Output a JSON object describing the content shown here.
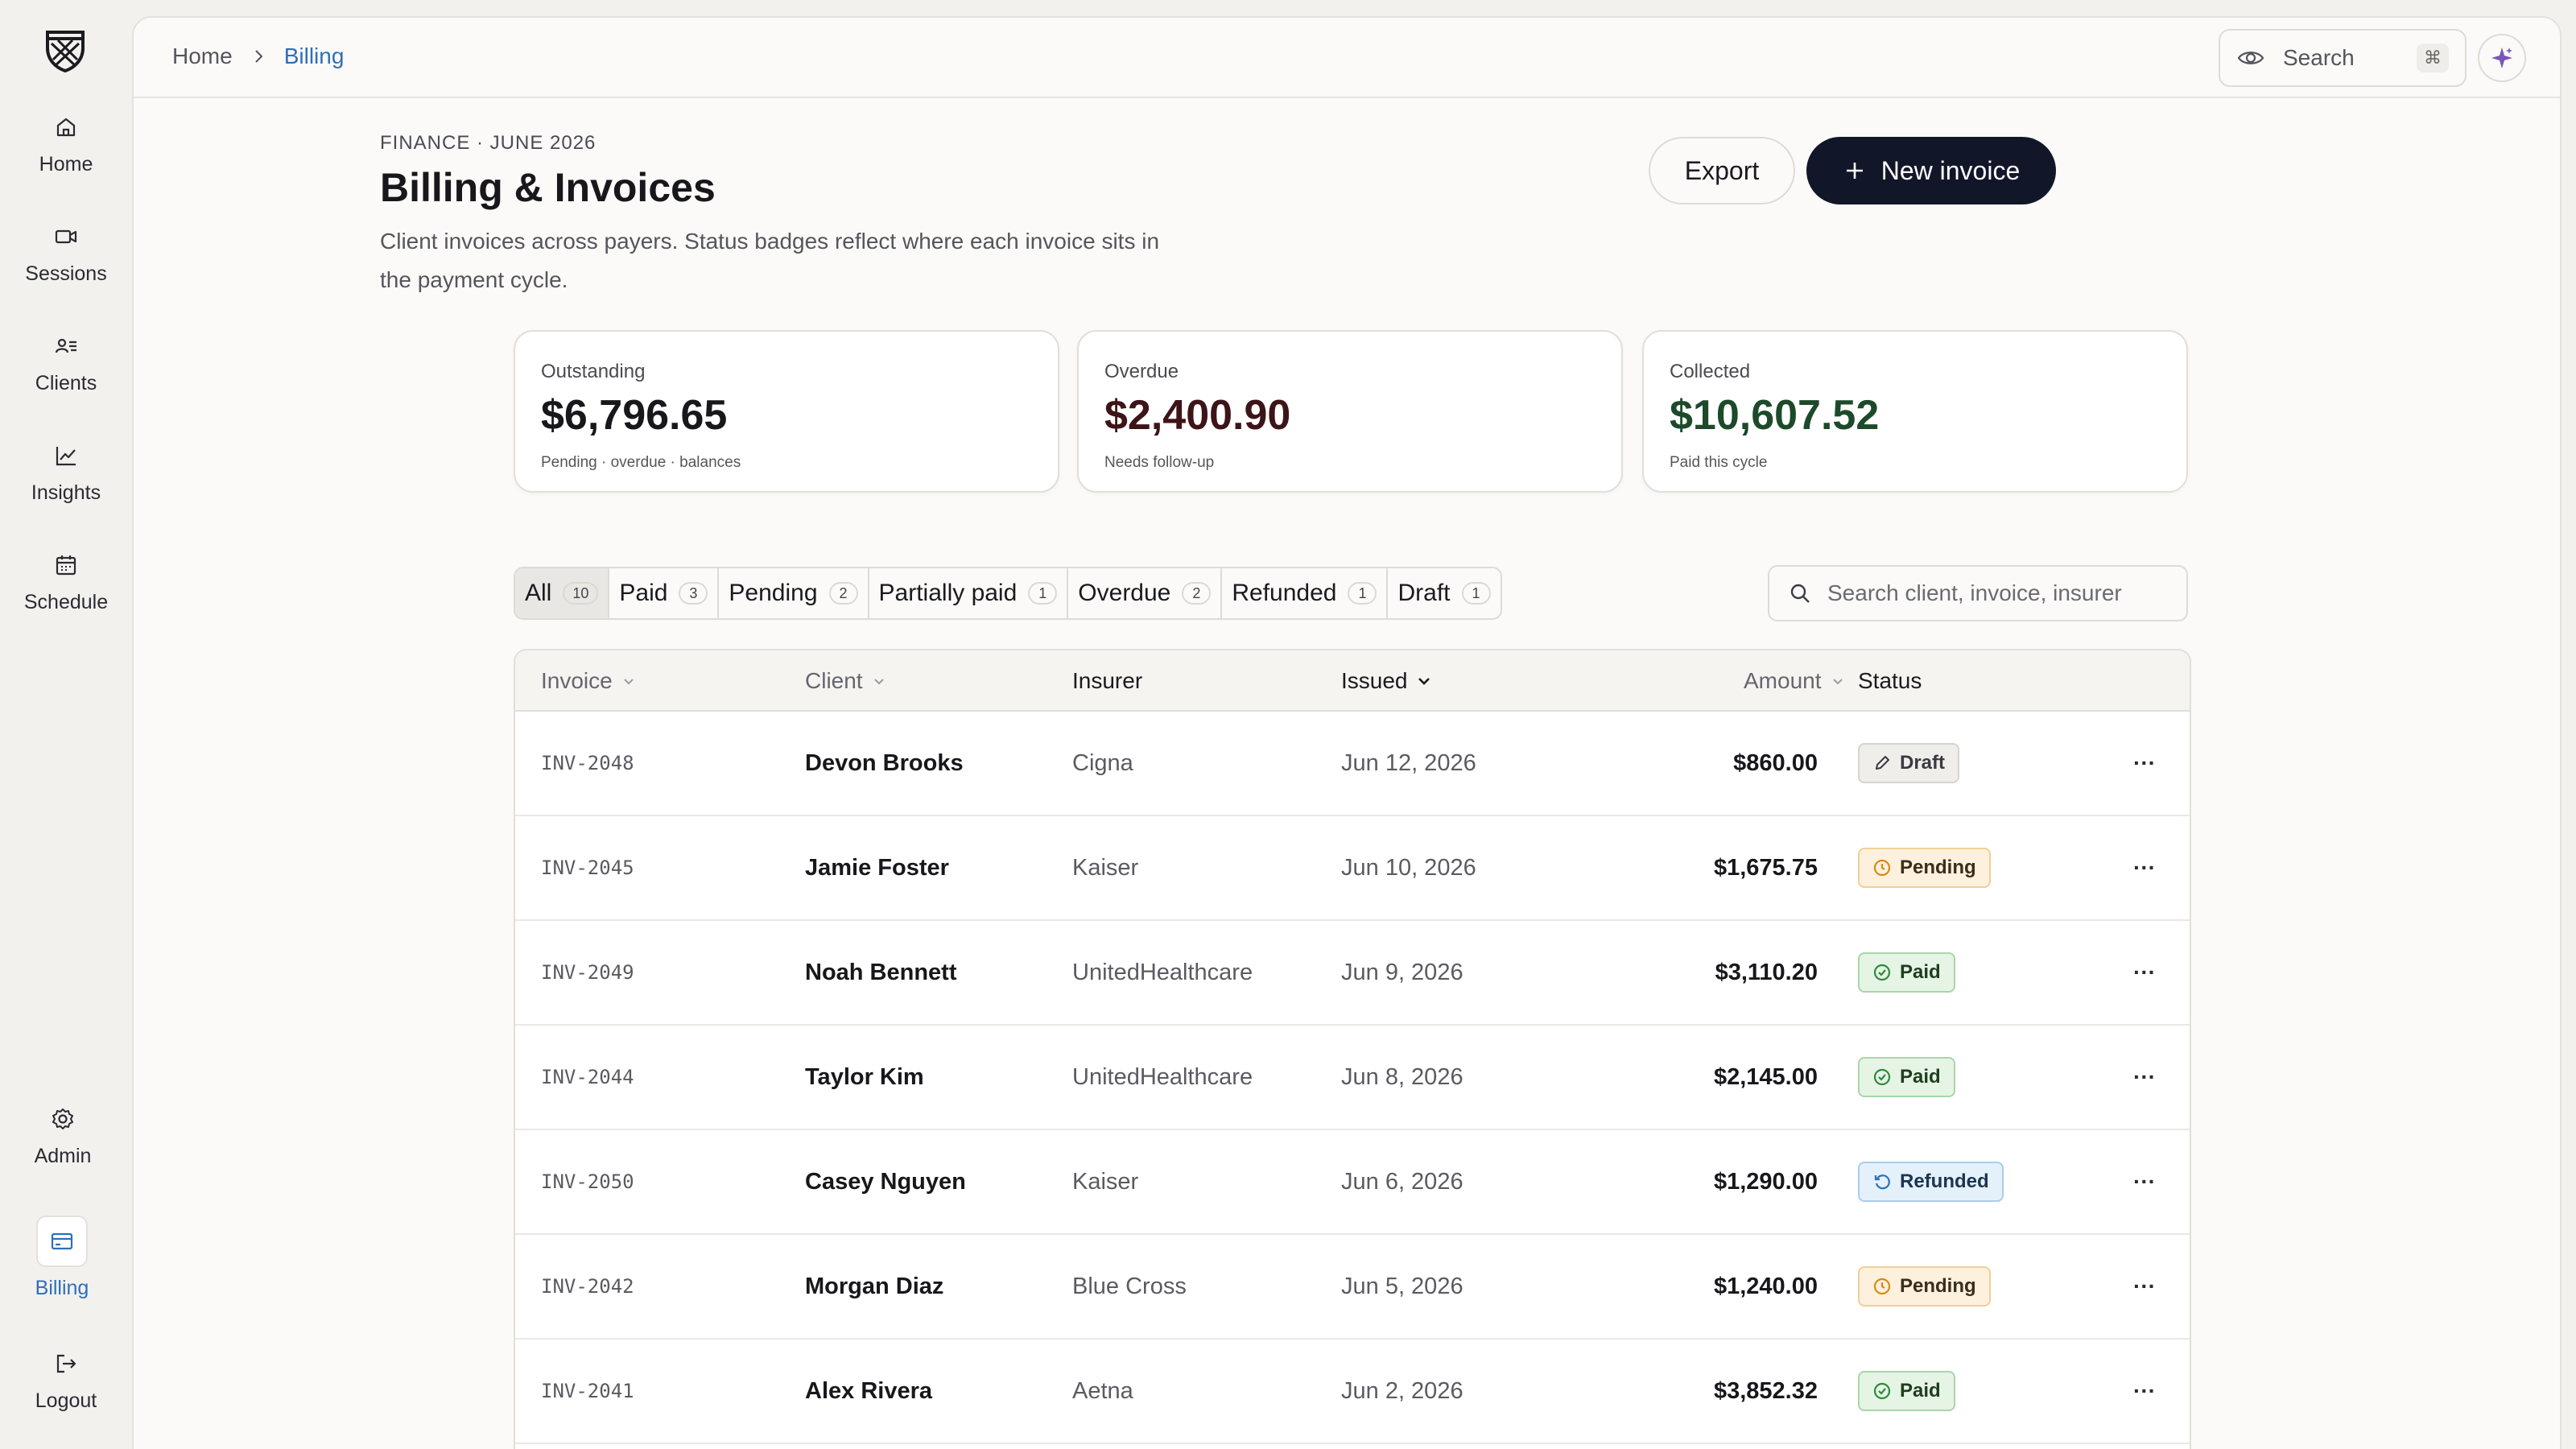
{
  "sidebar": {
    "items": [
      {
        "label": "Home",
        "icon": "home-icon"
      },
      {
        "label": "Sessions",
        "icon": "video-icon"
      },
      {
        "label": "Clients",
        "icon": "clients-icon"
      },
      {
        "label": "Insights",
        "icon": "chart-line-icon"
      },
      {
        "label": "Schedule",
        "icon": "calendar-icon"
      }
    ],
    "bottom": [
      {
        "label": "Admin",
        "icon": "gear-icon"
      },
      {
        "label": "Billing",
        "icon": "credit-card-icon",
        "active": true
      },
      {
        "label": "Logout",
        "icon": "logout-icon"
      }
    ]
  },
  "topbar": {
    "breadcrumb": {
      "home": "Home",
      "current": "Billing"
    },
    "search_label": "Search",
    "shortcut": "⌘"
  },
  "header": {
    "eyebrow": "FINANCE · JUNE 2026",
    "title": "Billing & Invoices",
    "subtitle": "Client invoices across payers. Status badges reflect where each invoice sits in the payment cycle.",
    "export_label": "Export",
    "new_invoice_label": "New invoice"
  },
  "stats": [
    {
      "label": "Outstanding",
      "value": "$6,796.65",
      "note": "Pending · overdue · balances",
      "color": "#17171c"
    },
    {
      "label": "Overdue",
      "value": "$2,400.90",
      "note": "Needs follow-up",
      "color": "#3d1418"
    },
    {
      "label": "Collected",
      "value": "$10,607.52",
      "note": "Paid this cycle",
      "color": "#1c4a2a"
    }
  ],
  "filters": [
    {
      "label": "All",
      "count": "10",
      "active": true
    },
    {
      "label": "Paid",
      "count": "3"
    },
    {
      "label": "Pending",
      "count": "2"
    },
    {
      "label": "Partially paid",
      "count": "1"
    },
    {
      "label": "Overdue",
      "count": "2"
    },
    {
      "label": "Refunded",
      "count": "1"
    },
    {
      "label": "Draft",
      "count": "1"
    }
  ],
  "table_search": {
    "placeholder": "Search client, invoice, insurer"
  },
  "table": {
    "columns": [
      "Invoice",
      "Client",
      "Insurer",
      "Issued",
      "Amount",
      "Status"
    ],
    "rows": [
      {
        "invoice": "INV-2048",
        "client": "Devon Brooks",
        "insurer": "Cigna",
        "issued": "Jun 12, 2026",
        "amount": "$860.00",
        "status": "Draft"
      },
      {
        "invoice": "INV-2045",
        "client": "Jamie Foster",
        "insurer": "Kaiser",
        "issued": "Jun 10, 2026",
        "amount": "$1,675.75",
        "status": "Pending"
      },
      {
        "invoice": "INV-2049",
        "client": "Noah Bennett",
        "insurer": "UnitedHealthcare",
        "issued": "Jun 9, 2026",
        "amount": "$3,110.20",
        "status": "Paid"
      },
      {
        "invoice": "INV-2044",
        "client": "Taylor Kim",
        "insurer": "UnitedHealthcare",
        "issued": "Jun 8, 2026",
        "amount": "$2,145.00",
        "status": "Paid"
      },
      {
        "invoice": "INV-2050",
        "client": "Casey Nguyen",
        "insurer": "Kaiser",
        "issued": "Jun 6, 2026",
        "amount": "$1,290.00",
        "status": "Refunded"
      },
      {
        "invoice": "INV-2042",
        "client": "Morgan Diaz",
        "insurer": "Blue Cross",
        "issued": "Jun 5, 2026",
        "amount": "$1,240.00",
        "status": "Pending"
      },
      {
        "invoice": "INV-2041",
        "client": "Alex Rivera",
        "insurer": "Aetna",
        "issued": "Jun 2, 2026",
        "amount": "$3,852.32",
        "status": "Paid"
      }
    ]
  },
  "colors": {
    "accent": "#2f6fb7",
    "primary_button": "#121629"
  }
}
